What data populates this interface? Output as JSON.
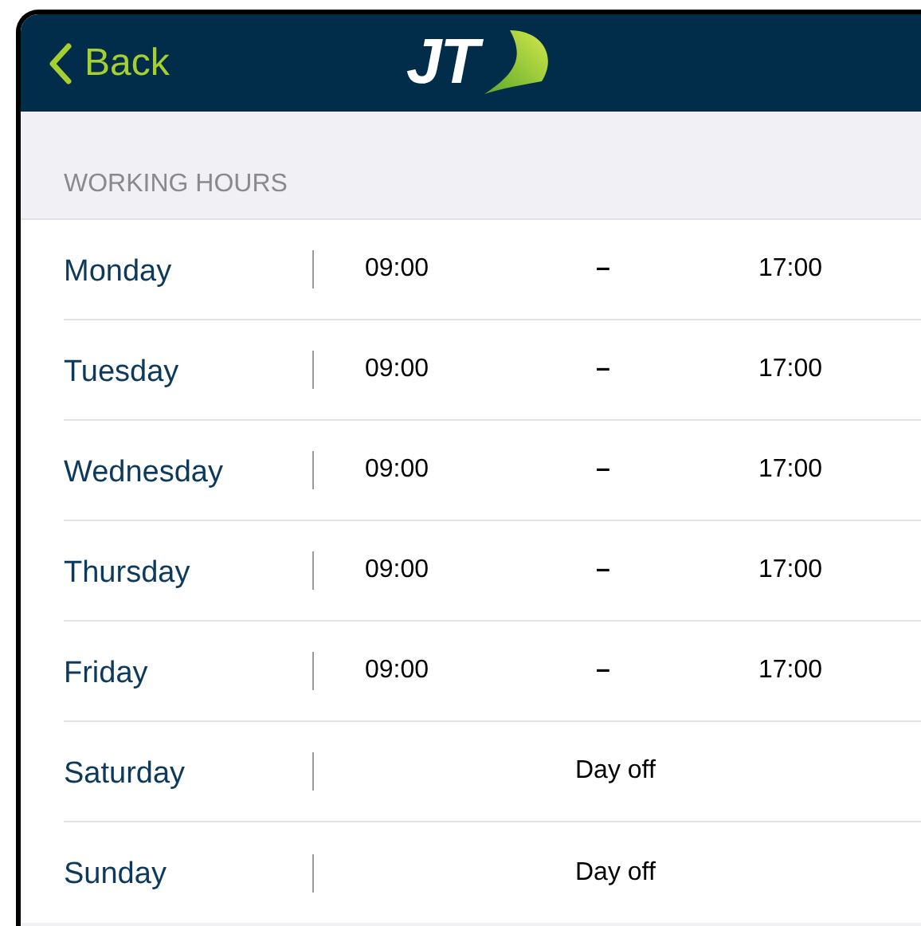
{
  "header": {
    "back_label": "Back",
    "logo_text": "JT"
  },
  "section": {
    "title": "WORKING HOURS"
  },
  "days": [
    {
      "name": "Monday",
      "kind": "hours",
      "start": "09:00",
      "separator": "–",
      "end": "17:00"
    },
    {
      "name": "Tuesday",
      "kind": "hours",
      "start": "09:00",
      "separator": "–",
      "end": "17:00"
    },
    {
      "name": "Wednesday",
      "kind": "hours",
      "start": "09:00",
      "separator": "–",
      "end": "17:00"
    },
    {
      "name": "Thursday",
      "kind": "hours",
      "start": "09:00",
      "separator": "–",
      "end": "17:00"
    },
    {
      "name": "Friday",
      "kind": "hours",
      "start": "09:00",
      "separator": "–",
      "end": "17:00"
    },
    {
      "name": "Saturday",
      "kind": "off",
      "note": "Day off"
    },
    {
      "name": "Sunday",
      "kind": "off",
      "note": "Day off"
    }
  ]
}
